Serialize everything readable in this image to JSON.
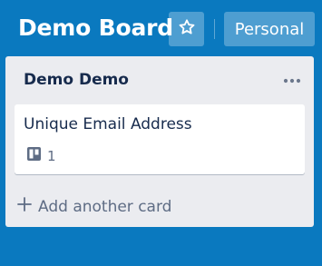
{
  "board": {
    "title": "Demo Board",
    "star_icon": "star-outline-icon",
    "visibility_label": "Personal"
  },
  "list": {
    "title": "Demo Demo",
    "menu_icon": "more-horizontal-icon",
    "cards": [
      {
        "title": "Unique Email Address",
        "badge_icon": "board-icon",
        "badge_count": "1"
      }
    ],
    "add_card_label": "Add another card",
    "add_icon": "plus-icon"
  },
  "colors": {
    "board_background": "#0a79bf",
    "list_background": "#ebecf0",
    "card_background": "#ffffff",
    "primary_text": "#172b4d",
    "secondary_text": "#5e6c84"
  }
}
